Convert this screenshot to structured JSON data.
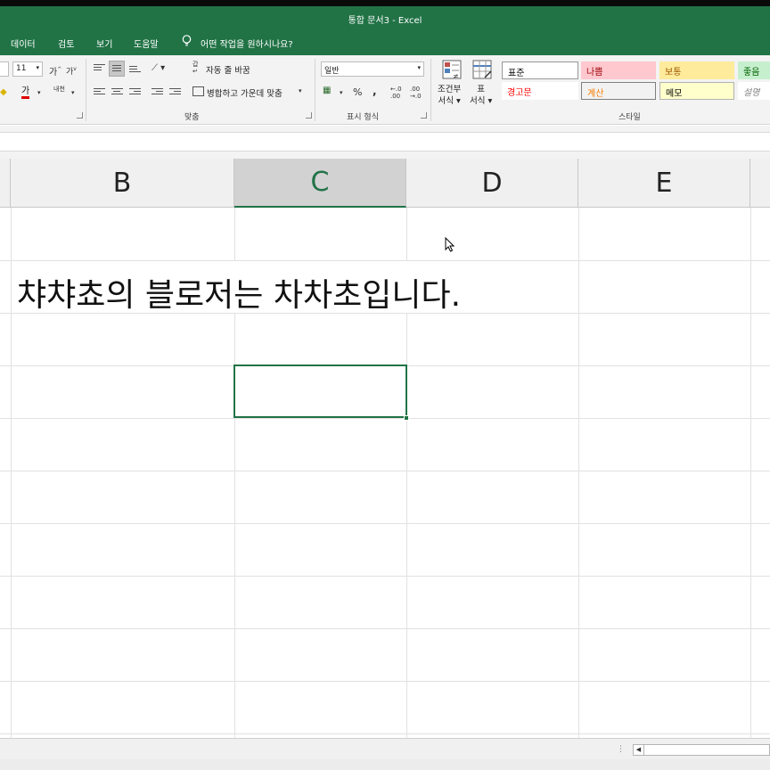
{
  "window": {
    "title": "통합 문서3  -  Excel"
  },
  "menu": {
    "items": [
      "데이터",
      "검토",
      "보기",
      "도움말"
    ],
    "tell_me": "어떤 작업을 원하시나요?"
  },
  "ribbon": {
    "font_size": "11",
    "grow_font": "가",
    "shrink_font": "가",
    "font_color_glyph": "가",
    "phonetic_glyph": "내천",
    "wrap_text": "자동 줄 바꿈",
    "merge_center": "병합하고 가운데 맞춤",
    "alignment_group": "맞춤",
    "number_format": "일반",
    "percent": "%",
    "comma": ",",
    "number_group": "표시 형식",
    "conditional_format_line1": "조건부",
    "conditional_format_line2": "서식",
    "table_format_line1": "표",
    "table_format_line2": "서식",
    "styles_group": "스타일",
    "styles": [
      {
        "label": "표준",
        "bg": "#ffffff",
        "fg": "#000000"
      },
      {
        "label": "나쁨",
        "bg": "#ffc7ce",
        "fg": "#9c0006"
      },
      {
        "label": "보통",
        "bg": "#ffeb9c",
        "fg": "#9c5700"
      },
      {
        "label": "좋음",
        "bg": "#c6efce",
        "fg": "#006100"
      },
      {
        "label": "경고문",
        "bg": "#ffffff",
        "fg": "#ff0000"
      },
      {
        "label": "계산",
        "bg": "#f2f2f2",
        "fg": "#fa7d00"
      },
      {
        "label": "메모",
        "bg": "#ffffcc",
        "fg": "#000000"
      },
      {
        "label": "설명",
        "bg": "#ffffff",
        "fg": "#7f7f7f"
      }
    ]
  },
  "columns": [
    {
      "label": "B",
      "active": false
    },
    {
      "label": "C",
      "active": true
    },
    {
      "label": "D",
      "active": false
    },
    {
      "label": "E",
      "active": false
    }
  ],
  "sheet": {
    "row2_text": "챠챠쵸의 블로저는 차차초입니다.",
    "selected_cell": "C4"
  },
  "colors": {
    "accent": "#217346"
  }
}
